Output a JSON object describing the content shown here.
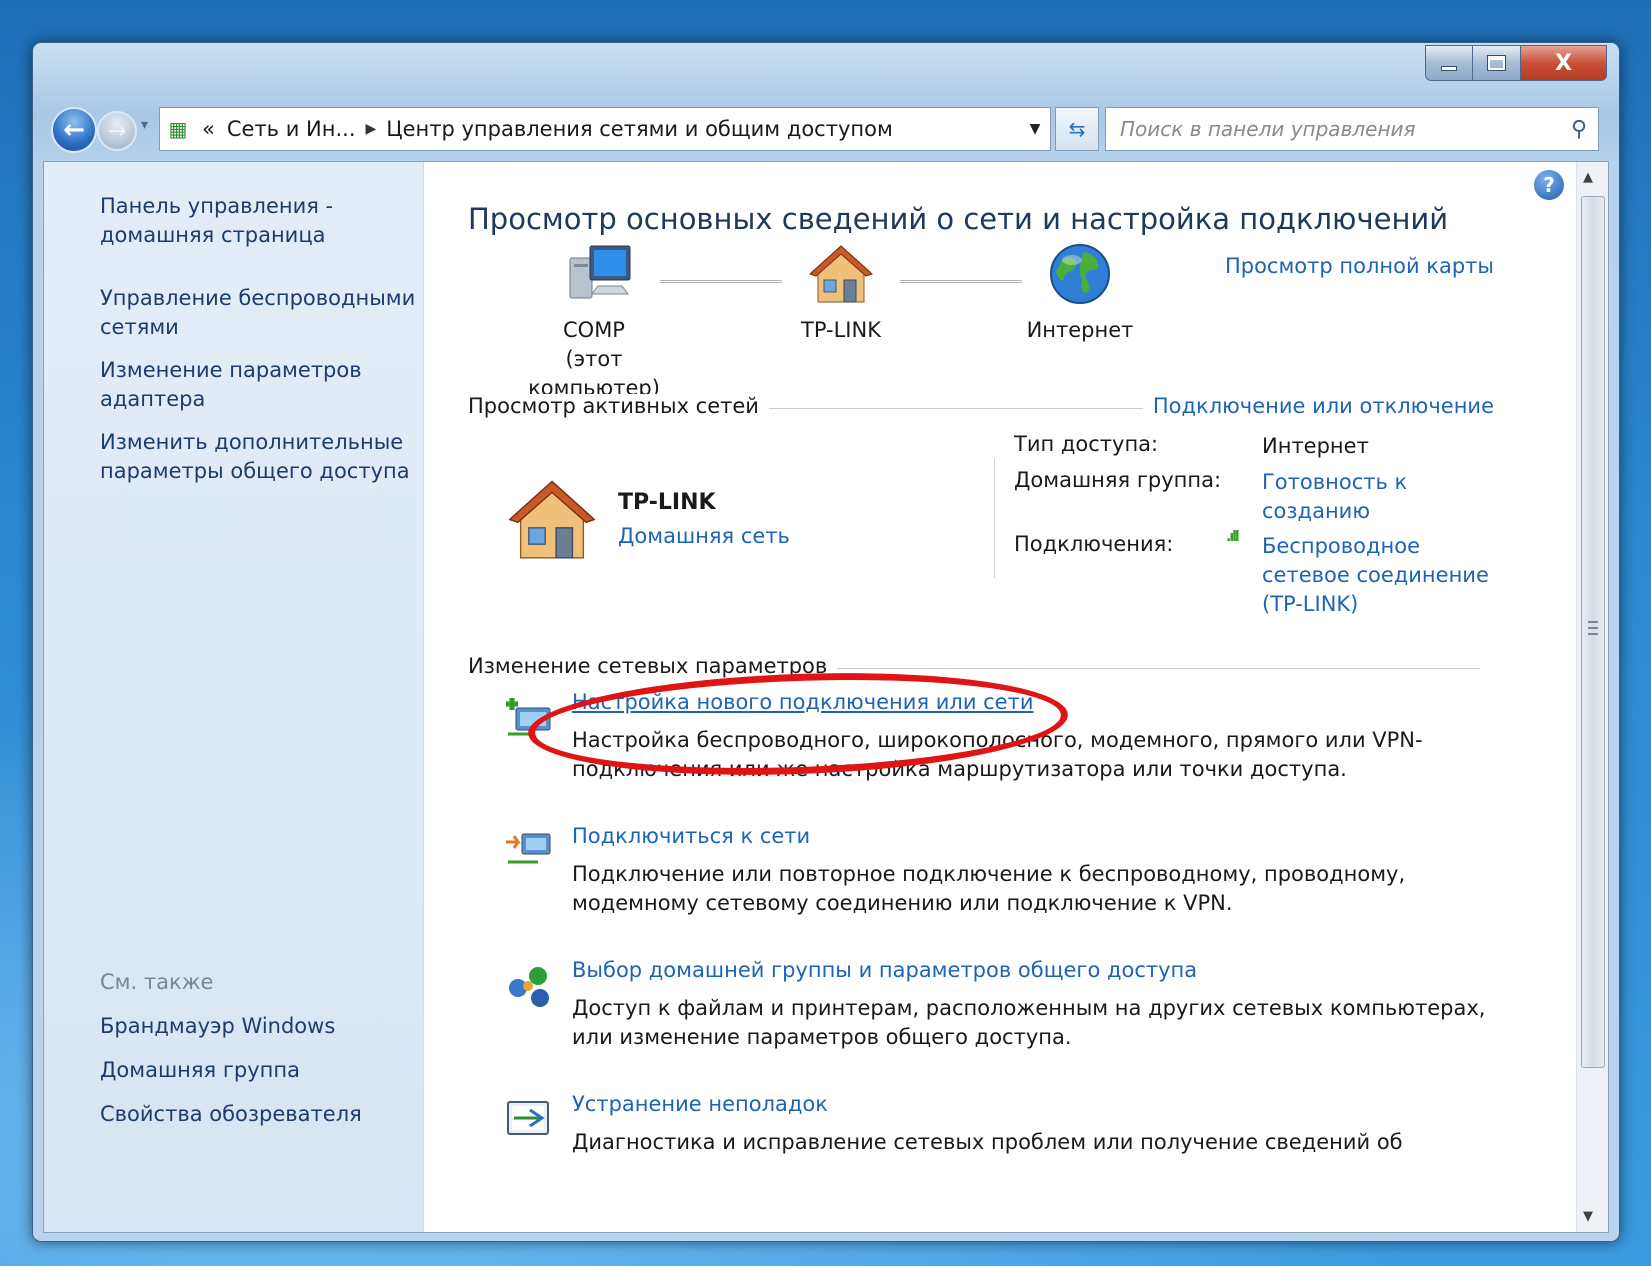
{
  "window": {
    "controls": {
      "minimize": "minimize",
      "maximize": "maximize",
      "close": "X"
    }
  },
  "toolbar": {
    "breadcrumb": [
      "«",
      "Сеть и Ин...",
      "Центр управления сетями и общим доступом"
    ],
    "search_placeholder": "Поиск в панели управления"
  },
  "sidebar": {
    "items": [
      "Панель управления - домашняя страница",
      "Управление беспроводными сетями",
      "Изменение параметров адаптера",
      "Изменить дополнительные параметры общего доступа"
    ],
    "see_also_label": "См. также",
    "see_also": [
      "Брандмауэр Windows",
      "Домашняя группа",
      "Свойства обозревателя"
    ]
  },
  "main": {
    "title": "Просмотр основных сведений о сети и настройка подключений",
    "full_map_link": "Просмотр полной карты",
    "map": {
      "computer_name": "COMP",
      "computer_sub": "(этот компьютер)",
      "router": "TP-LINK",
      "internet": "Интернет"
    },
    "active_networks": {
      "label": "Просмотр активных сетей",
      "connect_link": "Подключение или отключение",
      "network_name": "TP-LINK",
      "network_type": "Домашняя сеть",
      "access_type_label": "Тип доступа:",
      "access_type_value": "Интернет",
      "homegroup_label": "Домашняя группа:",
      "homegroup_value": "Готовность к созданию",
      "connections_label": "Подключения:",
      "connections_value": "Беспроводное сетевое соединение (TP-LINK)"
    },
    "change_settings": {
      "label": "Изменение сетевых параметров",
      "tasks": [
        {
          "title": "Настройка нового подключения или сети",
          "desc": "Настройка беспроводного, широкополосного, модемного, прямого или VPN-подключения или же настройка маршрутизатора или точки доступа."
        },
        {
          "title": "Подключиться к сети",
          "desc": "Подключение или повторное подключение к беспроводному, проводному, модемному сетевому соединению или подключение к VPN."
        },
        {
          "title": "Выбор домашней группы и параметров общего доступа",
          "desc": "Доступ к файлам и принтерам, расположенным на других сетевых компьютерах, или изменение параметров общего доступа."
        },
        {
          "title": "Устранение неполадок",
          "desc": "Диагностика и исправление сетевых проблем или получение сведений об"
        }
      ]
    }
  },
  "colors": {
    "link": "#1e64b4",
    "title": "#1e395b",
    "highlight_oval": "#e01414",
    "sidebar_bg": "#dce8f6"
  }
}
